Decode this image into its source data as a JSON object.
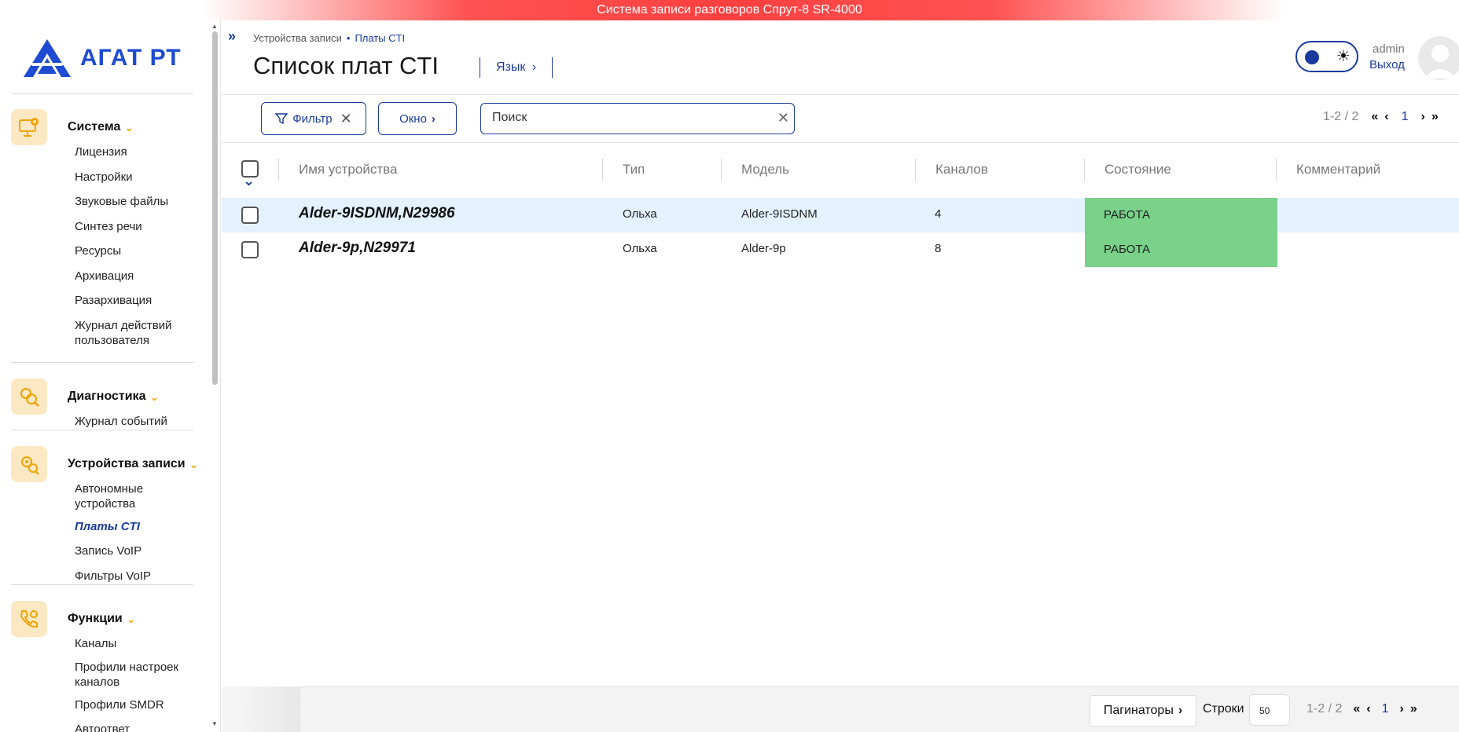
{
  "banner": {
    "text": "Система записи разговоров Спрут-8 SR-4000"
  },
  "logo": {
    "text": "АГАТ РТ"
  },
  "sidebar": {
    "groups": [
      {
        "title": "Система",
        "icon": "system-settings-icon",
        "items": [
          "Лицензия",
          "Настройки",
          "Звуковые файлы",
          "Синтез речи",
          "Ресурсы",
          "Архивация",
          "Разархивация",
          "Журнал действий пользователя"
        ]
      },
      {
        "title": "Диагностика",
        "icon": "diagnostics-icon",
        "items": [
          "Журнал событий"
        ]
      },
      {
        "title": "Устройства записи",
        "icon": "recording-devices-icon",
        "items": [
          "Автономные устройства",
          "Платы CTI",
          "Запись VoIP",
          "Фильтры VoIP"
        ],
        "active": "Платы CTI"
      },
      {
        "title": "Функции",
        "icon": "functions-phone-icon",
        "items": [
          "Каналы",
          "Профили настроек каналов",
          "Профили SMDR",
          "Автоответ"
        ]
      }
    ]
  },
  "breadcrumb": {
    "parent": "Устройства записи",
    "current": "Платы CTI"
  },
  "page": {
    "title": "Список плат CTI",
    "language_label": "Язык"
  },
  "user": {
    "name": "admin",
    "logout": "Выход"
  },
  "toolbar": {
    "filter_label": "Фильтр",
    "window_label": "Окно",
    "search_placeholder": "Поиск",
    "range": "1-2 / 2",
    "page": "1"
  },
  "table": {
    "columns": [
      "Имя устройства",
      "Тип",
      "Модель",
      "Каналов",
      "Состояние",
      "Комментарий"
    ],
    "rows": [
      {
        "name": "Alder-9ISDNM,N29986",
        "type": "Ольха",
        "model": "Alder-9ISDNM",
        "channels": "4",
        "state": "РАБОТА",
        "comment": "",
        "selected": true
      },
      {
        "name": "Alder-9p,N29971",
        "type": "Ольха",
        "model": "Alder-9p",
        "channels": "8",
        "state": "РАБОТА",
        "comment": "",
        "selected": false
      }
    ]
  },
  "footer": {
    "paginators_label": "Пагинаторы",
    "rows_label": "Строки",
    "rows_value": "50",
    "range": "1-2 / 2",
    "page": "1"
  },
  "colors": {
    "accent": "#1a3a9e",
    "status_ok": "#79d18a",
    "selected_row": "#e4f1fe",
    "icon_bg": "#fde8c4"
  }
}
